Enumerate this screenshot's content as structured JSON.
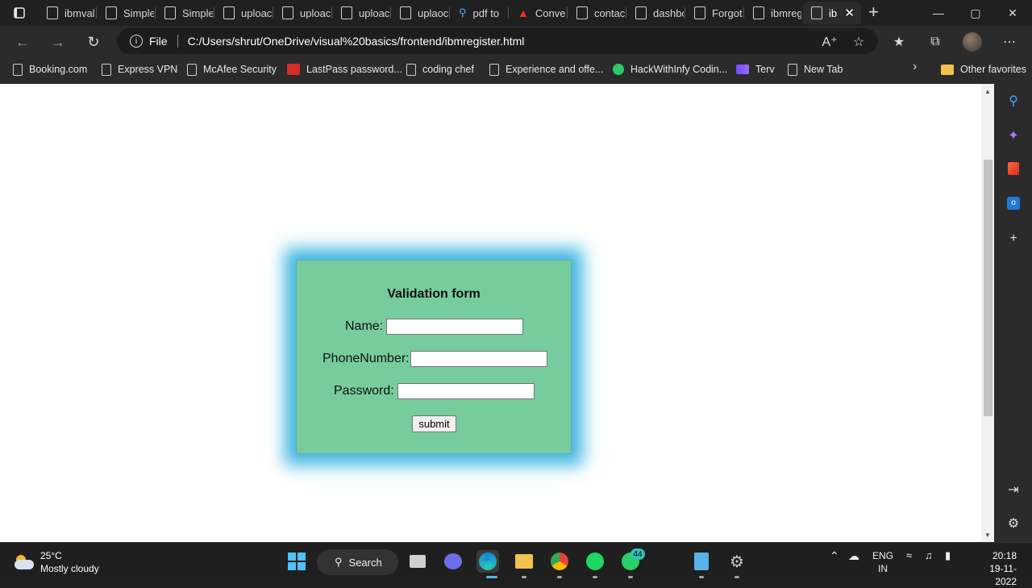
{
  "tabs": [
    {
      "label": "ibmval"
    },
    {
      "label": "Simple"
    },
    {
      "label": "Simple"
    },
    {
      "label": "uploac"
    },
    {
      "label": "uploac"
    },
    {
      "label": "uploac"
    },
    {
      "label": "uplaoc"
    },
    {
      "label": "pdf to"
    },
    {
      "label": "Conver"
    },
    {
      "label": "contac"
    },
    {
      "label": "dashbc"
    },
    {
      "label": "Forgot"
    },
    {
      "label": "ibmreg"
    },
    {
      "label": "ib"
    }
  ],
  "address": {
    "scheme_label": "File",
    "url": "C:/Users/shrut/OneDrive/visual%20basics/frontend/ibmregister.html"
  },
  "bookmarks": [
    {
      "label": "Booking.com",
      "icon": "page-icon"
    },
    {
      "label": "Express VPN",
      "icon": "page-icon"
    },
    {
      "label": "McAfee Security",
      "icon": "page-icon"
    },
    {
      "label": "LastPass password...",
      "icon": "lastpass-icon"
    },
    {
      "label": "coding chef",
      "icon": "page-icon"
    },
    {
      "label": "Experience and offe...",
      "icon": "page-icon"
    },
    {
      "label": "HackWithInfy Codin...",
      "icon": "hackwithinfy-icon"
    },
    {
      "label": "Terv",
      "icon": "terv-icon"
    },
    {
      "label": "New Tab",
      "icon": "page-icon"
    }
  ],
  "other_favorites": "Other favorites",
  "form": {
    "title": "Validation form",
    "name_label": "Name:",
    "phone_label": "PhoneNumber:",
    "password_label": "Password:",
    "submit_label": "submit"
  },
  "taskbar": {
    "temperature": "25°C",
    "weather": "Mostly cloudy",
    "search_label": "Search",
    "whatsapp_badge": "44",
    "lang_top": "ENG",
    "lang_bottom": "IN",
    "time": "20:18",
    "date": "19-11-2022"
  }
}
